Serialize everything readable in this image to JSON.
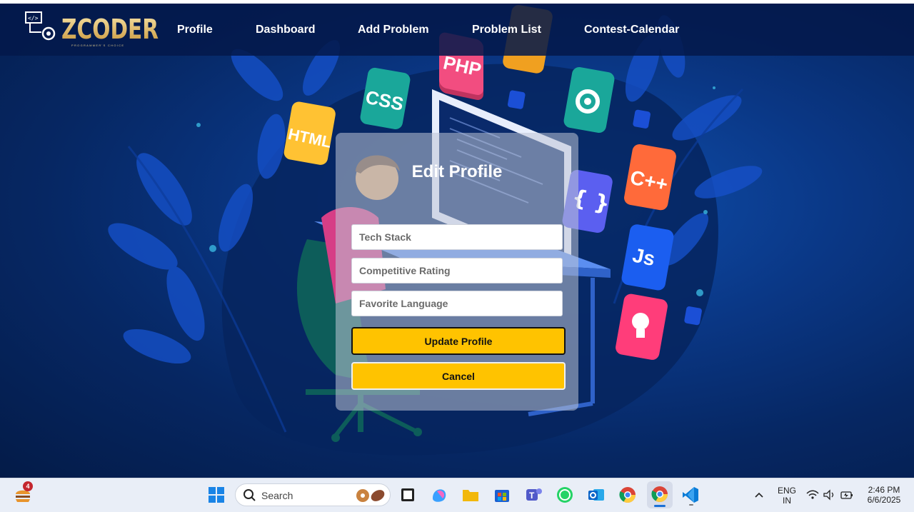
{
  "app": {
    "logo_text": "ZCODER",
    "logo_tagline": "PROGRAMMER'S CHOICE"
  },
  "nav": {
    "items": [
      {
        "label": "Profile"
      },
      {
        "label": "Dashboard"
      },
      {
        "label": "Add Problem"
      },
      {
        "label": "Problem List"
      },
      {
        "label": "Contest-Calendar"
      }
    ]
  },
  "background_badges": [
    "PHP",
    "CSS",
    "HTML",
    "C++",
    "Js",
    "{ }",
    "</>"
  ],
  "form": {
    "title": "Edit Profile",
    "fields": {
      "tech_stack": {
        "placeholder": "Tech Stack",
        "value": ""
      },
      "competitive_rating": {
        "placeholder": "Competitive Rating",
        "value": ""
      },
      "favorite_language": {
        "placeholder": "Favorite Language",
        "value": ""
      }
    },
    "update_label": "Update Profile",
    "cancel_label": "Cancel"
  },
  "taskbar": {
    "widget_badge": "4",
    "search_placeholder": "Search",
    "pinned_apps": [
      "windows-start-icon",
      "file-explorer-icon",
      "copilot-icon",
      "folder-icon",
      "microsoft-store-icon",
      "teams-icon",
      "whatsapp-icon",
      "outlook-icon",
      "chrome-icon",
      "chrome-active-icon",
      "vscode-icon"
    ],
    "language_line1": "ENG",
    "language_line2": "IN",
    "time": "2:46 PM",
    "date": "6/6/2025"
  },
  "colors": {
    "navbar": "#03194b",
    "accent_button": "#ffc300",
    "background": "#0a3785"
  }
}
